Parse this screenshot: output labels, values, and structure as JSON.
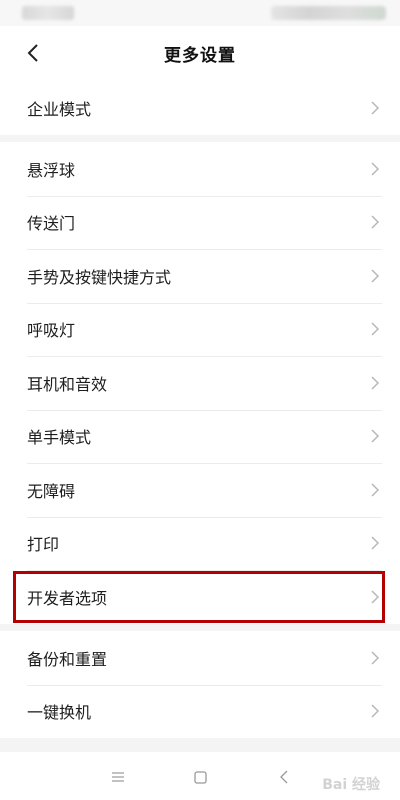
{
  "header": {
    "title": "更多设置"
  },
  "groups": [
    {
      "items": [
        {
          "label": "企业模式"
        }
      ]
    },
    {
      "items": [
        {
          "label": "悬浮球"
        },
        {
          "label": "传送门"
        },
        {
          "label": "手势及按键快捷方式"
        },
        {
          "label": "呼吸灯"
        },
        {
          "label": "耳机和音效"
        },
        {
          "label": "单手模式"
        },
        {
          "label": "无障碍"
        },
        {
          "label": "打印"
        },
        {
          "label": "开发者选项"
        }
      ]
    },
    {
      "items": [
        {
          "label": "备份和重置"
        },
        {
          "label": "一键换机"
        }
      ]
    }
  ],
  "highlight": {
    "target": "开发者选项",
    "color": "#b30000"
  },
  "watermark": "Bai 经验",
  "icons": {
    "back": "chevron-left-icon",
    "row_arrow": "chevron-right-icon",
    "nav_menu": "menu-icon",
    "nav_home": "square-icon",
    "nav_back": "back-triangle-icon"
  }
}
